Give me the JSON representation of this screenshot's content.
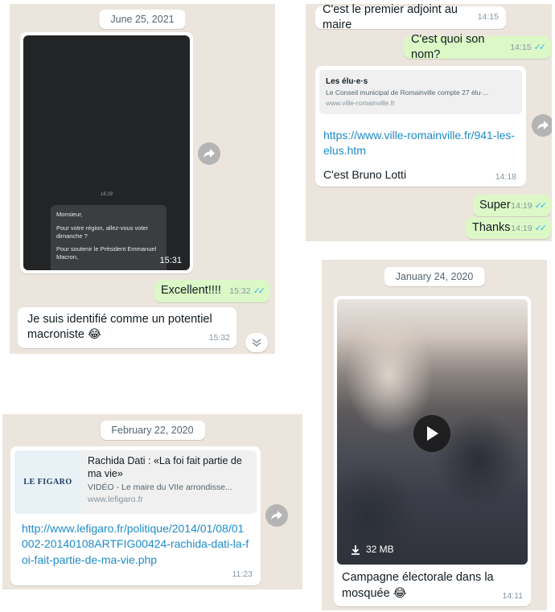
{
  "panel_a": {
    "date_chip": "June 25, 2021",
    "screenshot_message": {
      "inner_time": "16:29",
      "inner_lines": [
        "Monsieur,",
        "Pour votre région, allez-vous voter dimanche ?",
        "Pour soutenir le Président Emmanuel Macron,"
      ],
      "time": "15:31"
    },
    "reply_out": {
      "text": "Excellent!!!!",
      "time": "15:32",
      "ticks": "✓✓"
    },
    "reply_in": {
      "text": "Je suis identifié comme un potentiel macroniste 😂",
      "time": "15:32"
    }
  },
  "panel_b": {
    "msg1": {
      "text": "C'est le premier adjoint au maire",
      "time": "14:15"
    },
    "msg2": {
      "text": "C'est quoi son nom?",
      "time": "14:15",
      "ticks": "✓✓"
    },
    "link_message": {
      "preview_title": "Les élu·e·s",
      "preview_desc": "Le Conseil municipal de Romainville compte 27 élu·...",
      "preview_domain": "www.ville-romainville.fr",
      "url": "https://www.ville-romainville.fr/941-les-elus.htm",
      "text": "C'est Bruno Lotti",
      "time": "14:18"
    },
    "msg3": {
      "text": "Super",
      "time": "14:19",
      "ticks": "✓✓"
    },
    "msg4": {
      "text": "Thanks",
      "time": "14:19",
      "ticks": "✓✓"
    }
  },
  "panel_c": {
    "date_chip": "February 22, 2020",
    "link_message": {
      "logo_text": "LE FIGARO",
      "preview_title": "Rachida Dati : «La foi fait partie de ma vie»",
      "preview_desc": "VIDÉO - Le maire du VIIe arrondisse...",
      "preview_domain": "www.lefigaro.fr",
      "url": "http://www.lefigaro.fr/politique/2014/01/08/01002-20140108ARTFIG00424-rachida-dati-la-foi-fait-partie-de-ma-vie.php",
      "time": "11:23"
    }
  },
  "panel_d": {
    "date_chip": "January 24, 2020",
    "video_message": {
      "size": "32 MB",
      "caption": "Campagne électorale dans la mosquée 😂",
      "time": "14:11"
    }
  },
  "icons": [
    "forward-icon",
    "scroll-down-icon",
    "play-icon",
    "download-icon"
  ],
  "colors": {
    "chat_bg": "#ece5dd",
    "outgoing": "#dcf8c6",
    "incoming": "#ffffff",
    "link": "#1d8cc9",
    "read_ticks": "#34b7f1"
  }
}
